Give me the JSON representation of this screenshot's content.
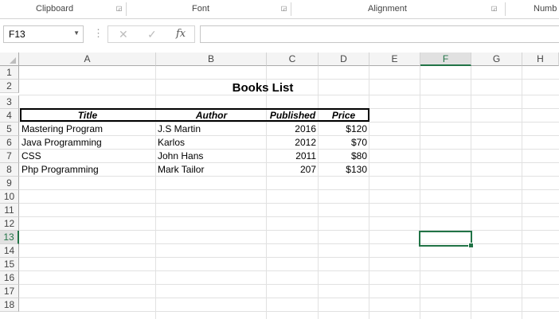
{
  "ribbon": {
    "groups": [
      {
        "label": "Clipboard"
      },
      {
        "label": "Font"
      },
      {
        "label": "Alignment"
      },
      {
        "label": "Numb"
      }
    ]
  },
  "formula_bar": {
    "name_box": "F13",
    "formula": "",
    "cancel_glyph": "✕",
    "enter_glyph": "✓",
    "fx_glyph": "fx"
  },
  "columns": [
    "A",
    "B",
    "C",
    "D",
    "E",
    "F",
    "G",
    "H"
  ],
  "selected_column": "F",
  "rows": [
    "1",
    "2",
    "3",
    "4",
    "5",
    "6",
    "7",
    "8",
    "9",
    "10",
    "11",
    "12",
    "13",
    "14",
    "15",
    "16",
    "17",
    "18"
  ],
  "selected_row": "13",
  "sheet": {
    "title": "Books List",
    "headers": {
      "title": "Title",
      "author": "Author",
      "published": "Published",
      "price": "Price"
    },
    "books": [
      {
        "title": "Mastering Program",
        "author": "J.S Martin",
        "published": "2016",
        "price": "$120"
      },
      {
        "title": "Java Programming",
        "author": "Karlos",
        "published": "2012",
        "price": "$70"
      },
      {
        "title": "CSS",
        "author": "John Hans",
        "published": "2011",
        "price": "$80"
      },
      {
        "title": "Php Programming",
        "author": "Mark Tailor",
        "published": "207",
        "price": "$130"
      }
    ]
  },
  "colors": {
    "accent": "#217346",
    "gridline": "#e1e1e1"
  }
}
